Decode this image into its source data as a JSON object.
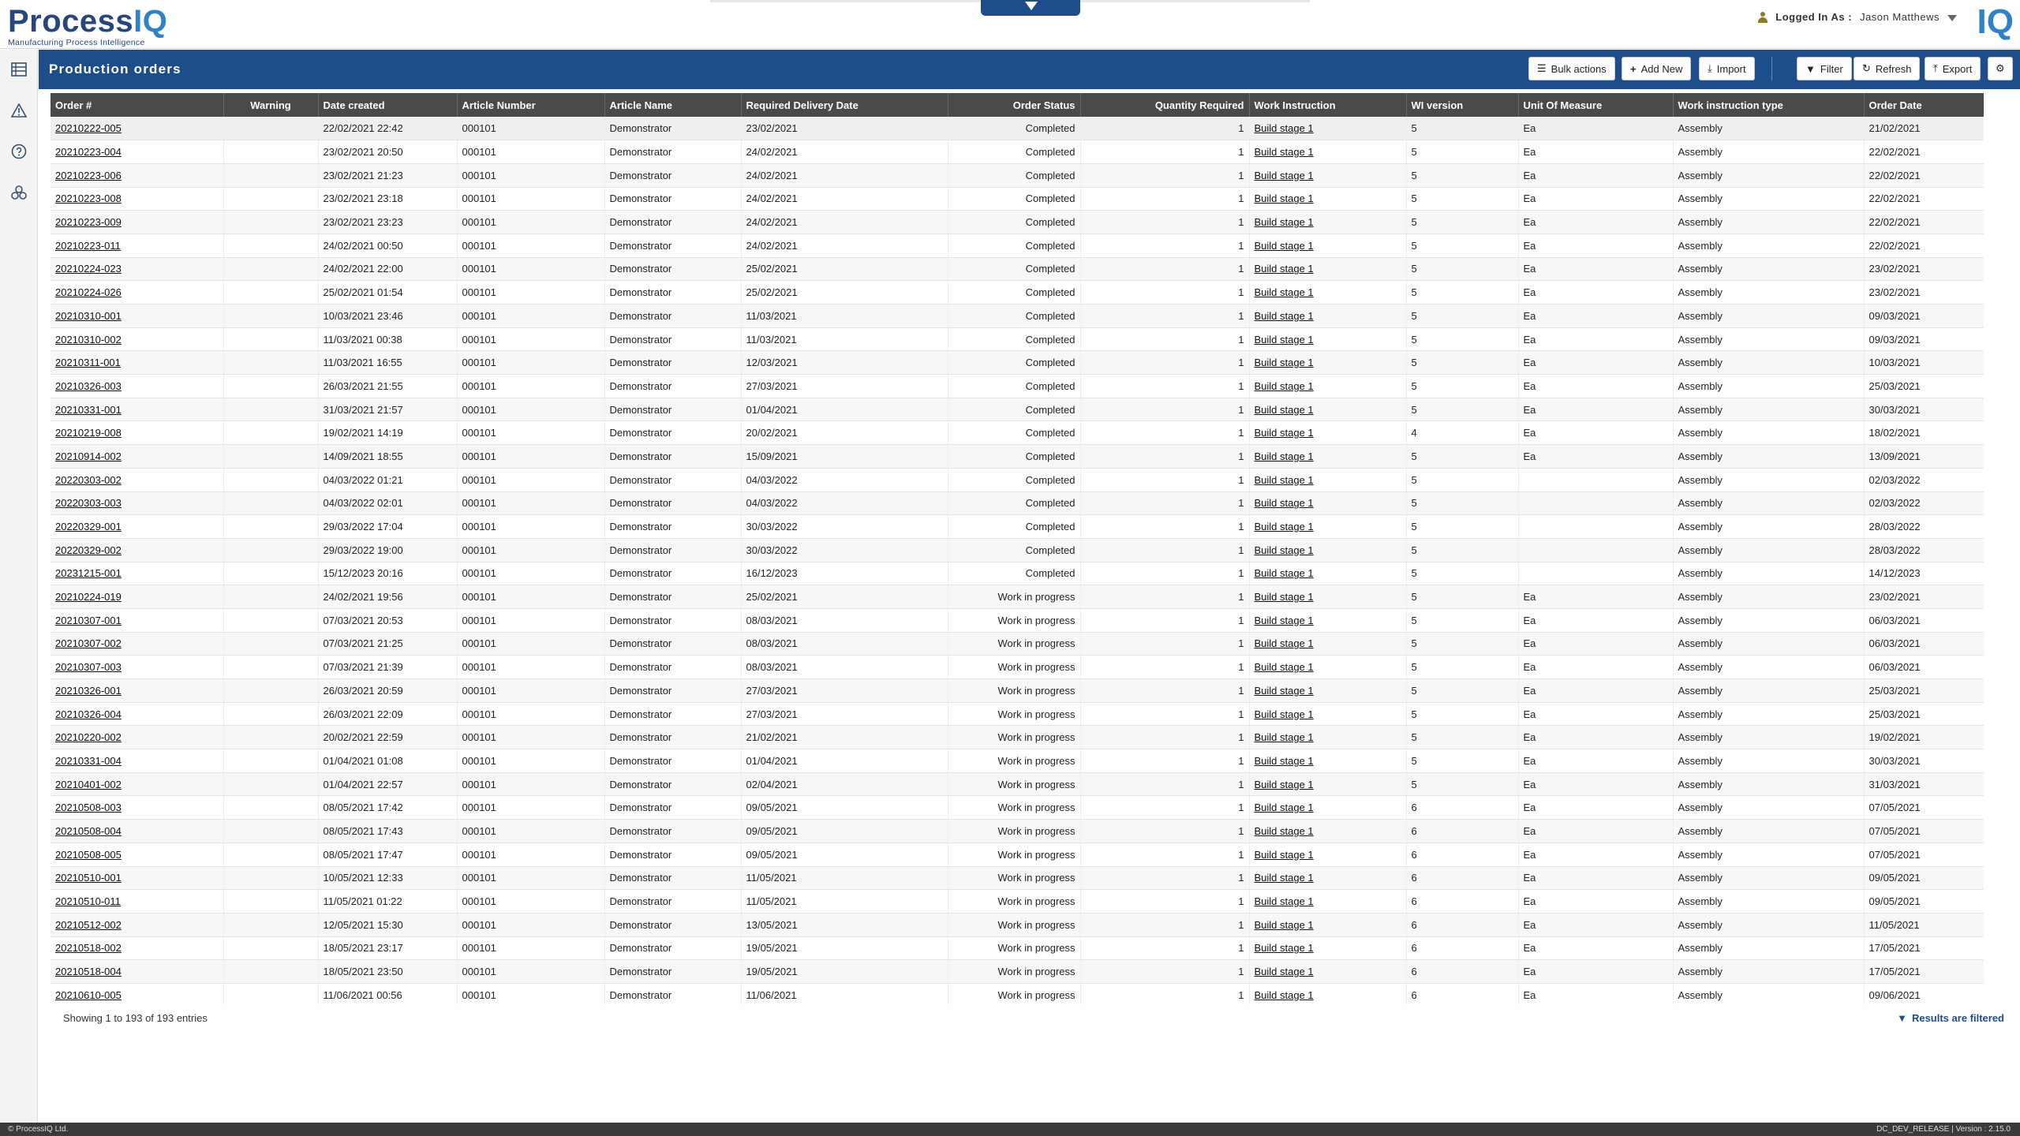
{
  "header": {
    "logo_main": "Process",
    "logo_iq": "IQ",
    "logo_tagline": "Manufacturing Process Intelligence",
    "logged_in_label": "Logged In As :",
    "user_name": "Jason Matthews",
    "brand_mark": "IQ"
  },
  "toolbar": {
    "title": "Production orders",
    "bulk_actions": "Bulk actions",
    "add_new": "Add New",
    "import": "Import",
    "filter": "Filter",
    "refresh": "Refresh",
    "export": "Export"
  },
  "table": {
    "columns": [
      "Order #",
      "Warning",
      "Date created",
      "Article Number",
      "Article Name",
      "Required Delivery Date",
      "Order Status",
      "Quantity Required",
      "Work Instruction",
      "WI version",
      "Unit Of Measure",
      "Work instruction type",
      "Order Date"
    ],
    "rows": [
      [
        "20210222-005",
        "",
        "22/02/2021 22:42",
        "000101",
        "Demonstrator",
        "23/02/2021",
        "Completed",
        "1",
        "Build stage 1",
        "5",
        "Ea",
        "Assembly",
        "21/02/2021"
      ],
      [
        "20210223-004",
        "",
        "23/02/2021 20:50",
        "000101",
        "Demonstrator",
        "24/02/2021",
        "Completed",
        "1",
        "Build stage 1",
        "5",
        "Ea",
        "Assembly",
        "22/02/2021"
      ],
      [
        "20210223-006",
        "",
        "23/02/2021 21:23",
        "000101",
        "Demonstrator",
        "24/02/2021",
        "Completed",
        "1",
        "Build stage 1",
        "5",
        "Ea",
        "Assembly",
        "22/02/2021"
      ],
      [
        "20210223-008",
        "",
        "23/02/2021 23:18",
        "000101",
        "Demonstrator",
        "24/02/2021",
        "Completed",
        "1",
        "Build stage 1",
        "5",
        "Ea",
        "Assembly",
        "22/02/2021"
      ],
      [
        "20210223-009",
        "",
        "23/02/2021 23:23",
        "000101",
        "Demonstrator",
        "24/02/2021",
        "Completed",
        "1",
        "Build stage 1",
        "5",
        "Ea",
        "Assembly",
        "22/02/2021"
      ],
      [
        "20210223-011",
        "",
        "24/02/2021 00:50",
        "000101",
        "Demonstrator",
        "24/02/2021",
        "Completed",
        "1",
        "Build stage 1",
        "5",
        "Ea",
        "Assembly",
        "22/02/2021"
      ],
      [
        "20210224-023",
        "",
        "24/02/2021 22:00",
        "000101",
        "Demonstrator",
        "25/02/2021",
        "Completed",
        "1",
        "Build stage 1",
        "5",
        "Ea",
        "Assembly",
        "23/02/2021"
      ],
      [
        "20210224-026",
        "",
        "25/02/2021 01:54",
        "000101",
        "Demonstrator",
        "25/02/2021",
        "Completed",
        "1",
        "Build stage 1",
        "5",
        "Ea",
        "Assembly",
        "23/02/2021"
      ],
      [
        "20210310-001",
        "",
        "10/03/2021 23:46",
        "000101",
        "Demonstrator",
        "11/03/2021",
        "Completed",
        "1",
        "Build stage 1",
        "5",
        "Ea",
        "Assembly",
        "09/03/2021"
      ],
      [
        "20210310-002",
        "",
        "11/03/2021 00:38",
        "000101",
        "Demonstrator",
        "11/03/2021",
        "Completed",
        "1",
        "Build stage 1",
        "5",
        "Ea",
        "Assembly",
        "09/03/2021"
      ],
      [
        "20210311-001",
        "",
        "11/03/2021 16:55",
        "000101",
        "Demonstrator",
        "12/03/2021",
        "Completed",
        "1",
        "Build stage 1",
        "5",
        "Ea",
        "Assembly",
        "10/03/2021"
      ],
      [
        "20210326-003",
        "",
        "26/03/2021 21:55",
        "000101",
        "Demonstrator",
        "27/03/2021",
        "Completed",
        "1",
        "Build stage 1",
        "5",
        "Ea",
        "Assembly",
        "25/03/2021"
      ],
      [
        "20210331-001",
        "",
        "31/03/2021 21:57",
        "000101",
        "Demonstrator",
        "01/04/2021",
        "Completed",
        "1",
        "Build stage 1",
        "5",
        "Ea",
        "Assembly",
        "30/03/2021"
      ],
      [
        "20210219-008",
        "",
        "19/02/2021 14:19",
        "000101",
        "Demonstrator",
        "20/02/2021",
        "Completed",
        "1",
        "Build stage 1",
        "4",
        "Ea",
        "Assembly",
        "18/02/2021"
      ],
      [
        "20210914-002",
        "",
        "14/09/2021 18:55",
        "000101",
        "Demonstrator",
        "15/09/2021",
        "Completed",
        "1",
        "Build stage 1",
        "5",
        "Ea",
        "Assembly",
        "13/09/2021"
      ],
      [
        "20220303-002",
        "",
        "04/03/2022 01:21",
        "000101",
        "Demonstrator",
        "04/03/2022",
        "Completed",
        "1",
        "Build stage 1",
        "5",
        "",
        "Assembly",
        "02/03/2022"
      ],
      [
        "20220303-003",
        "",
        "04/03/2022 02:01",
        "000101",
        "Demonstrator",
        "04/03/2022",
        "Completed",
        "1",
        "Build stage 1",
        "5",
        "",
        "Assembly",
        "02/03/2022"
      ],
      [
        "20220329-001",
        "",
        "29/03/2022 17:04",
        "000101",
        "Demonstrator",
        "30/03/2022",
        "Completed",
        "1",
        "Build stage 1",
        "5",
        "",
        "Assembly",
        "28/03/2022"
      ],
      [
        "20220329-002",
        "",
        "29/03/2022 19:00",
        "000101",
        "Demonstrator",
        "30/03/2022",
        "Completed",
        "1",
        "Build stage 1",
        "5",
        "",
        "Assembly",
        "28/03/2022"
      ],
      [
        "20231215-001",
        "",
        "15/12/2023 20:16",
        "000101",
        "Demonstrator",
        "16/12/2023",
        "Completed",
        "1",
        "Build stage 1",
        "5",
        "",
        "Assembly",
        "14/12/2023"
      ],
      [
        "20210224-019",
        "",
        "24/02/2021 19:56",
        "000101",
        "Demonstrator",
        "25/02/2021",
        "Work in progress",
        "1",
        "Build stage 1",
        "5",
        "Ea",
        "Assembly",
        "23/02/2021"
      ],
      [
        "20210307-001",
        "",
        "07/03/2021 20:53",
        "000101",
        "Demonstrator",
        "08/03/2021",
        "Work in progress",
        "1",
        "Build stage 1",
        "5",
        "Ea",
        "Assembly",
        "06/03/2021"
      ],
      [
        "20210307-002",
        "",
        "07/03/2021 21:25",
        "000101",
        "Demonstrator",
        "08/03/2021",
        "Work in progress",
        "1",
        "Build stage 1",
        "5",
        "Ea",
        "Assembly",
        "06/03/2021"
      ],
      [
        "20210307-003",
        "",
        "07/03/2021 21:39",
        "000101",
        "Demonstrator",
        "08/03/2021",
        "Work in progress",
        "1",
        "Build stage 1",
        "5",
        "Ea",
        "Assembly",
        "06/03/2021"
      ],
      [
        "20210326-001",
        "",
        "26/03/2021 20:59",
        "000101",
        "Demonstrator",
        "27/03/2021",
        "Work in progress",
        "1",
        "Build stage 1",
        "5",
        "Ea",
        "Assembly",
        "25/03/2021"
      ],
      [
        "20210326-004",
        "",
        "26/03/2021 22:09",
        "000101",
        "Demonstrator",
        "27/03/2021",
        "Work in progress",
        "1",
        "Build stage 1",
        "5",
        "Ea",
        "Assembly",
        "25/03/2021"
      ],
      [
        "20210220-002",
        "",
        "20/02/2021 22:59",
        "000101",
        "Demonstrator",
        "21/02/2021",
        "Work in progress",
        "1",
        "Build stage 1",
        "5",
        "Ea",
        "Assembly",
        "19/02/2021"
      ],
      [
        "20210331-004",
        "",
        "01/04/2021 01:08",
        "000101",
        "Demonstrator",
        "01/04/2021",
        "Work in progress",
        "1",
        "Build stage 1",
        "5",
        "Ea",
        "Assembly",
        "30/03/2021"
      ],
      [
        "20210401-002",
        "",
        "01/04/2021 22:57",
        "000101",
        "Demonstrator",
        "02/04/2021",
        "Work in progress",
        "1",
        "Build stage 1",
        "5",
        "Ea",
        "Assembly",
        "31/03/2021"
      ],
      [
        "20210508-003",
        "",
        "08/05/2021 17:42",
        "000101",
        "Demonstrator",
        "09/05/2021",
        "Work in progress",
        "1",
        "Build stage 1",
        "6",
        "Ea",
        "Assembly",
        "07/05/2021"
      ],
      [
        "20210508-004",
        "",
        "08/05/2021 17:43",
        "000101",
        "Demonstrator",
        "09/05/2021",
        "Work in progress",
        "1",
        "Build stage 1",
        "6",
        "Ea",
        "Assembly",
        "07/05/2021"
      ],
      [
        "20210508-005",
        "",
        "08/05/2021 17:47",
        "000101",
        "Demonstrator",
        "09/05/2021",
        "Work in progress",
        "1",
        "Build stage 1",
        "6",
        "Ea",
        "Assembly",
        "07/05/2021"
      ],
      [
        "20210510-001",
        "",
        "10/05/2021 12:33",
        "000101",
        "Demonstrator",
        "11/05/2021",
        "Work in progress",
        "1",
        "Build stage 1",
        "6",
        "Ea",
        "Assembly",
        "09/05/2021"
      ],
      [
        "20210510-011",
        "",
        "11/05/2021 01:22",
        "000101",
        "Demonstrator",
        "11/05/2021",
        "Work in progress",
        "1",
        "Build stage 1",
        "6",
        "Ea",
        "Assembly",
        "09/05/2021"
      ],
      [
        "20210512-002",
        "",
        "12/05/2021 15:30",
        "000101",
        "Demonstrator",
        "13/05/2021",
        "Work in progress",
        "1",
        "Build stage 1",
        "6",
        "Ea",
        "Assembly",
        "11/05/2021"
      ],
      [
        "20210518-002",
        "",
        "18/05/2021 23:17",
        "000101",
        "Demonstrator",
        "19/05/2021",
        "Work in progress",
        "1",
        "Build stage 1",
        "6",
        "Ea",
        "Assembly",
        "17/05/2021"
      ],
      [
        "20210518-004",
        "",
        "18/05/2021 23:50",
        "000101",
        "Demonstrator",
        "19/05/2021",
        "Work in progress",
        "1",
        "Build stage 1",
        "6",
        "Ea",
        "Assembly",
        "17/05/2021"
      ],
      [
        "20210610-005",
        "",
        "11/06/2021 00:56",
        "000101",
        "Demonstrator",
        "11/06/2021",
        "Work in progress",
        "1",
        "Build stage 1",
        "6",
        "Ea",
        "Assembly",
        "09/06/2021"
      ]
    ]
  },
  "footer": {
    "showing": "Showing 1 to 193 of 193 entries",
    "filtered": "Results are filtered"
  },
  "statusbar": {
    "left": "© ProcessIQ Ltd.",
    "right": "DC_DEV_RELEASE | Version : 2.15.0"
  },
  "colors": {
    "brand_dark": "#27467d",
    "brand_light": "#2f82c6",
    "titlebar": "#1e4d8c",
    "table_header": "#4a4a4a"
  }
}
